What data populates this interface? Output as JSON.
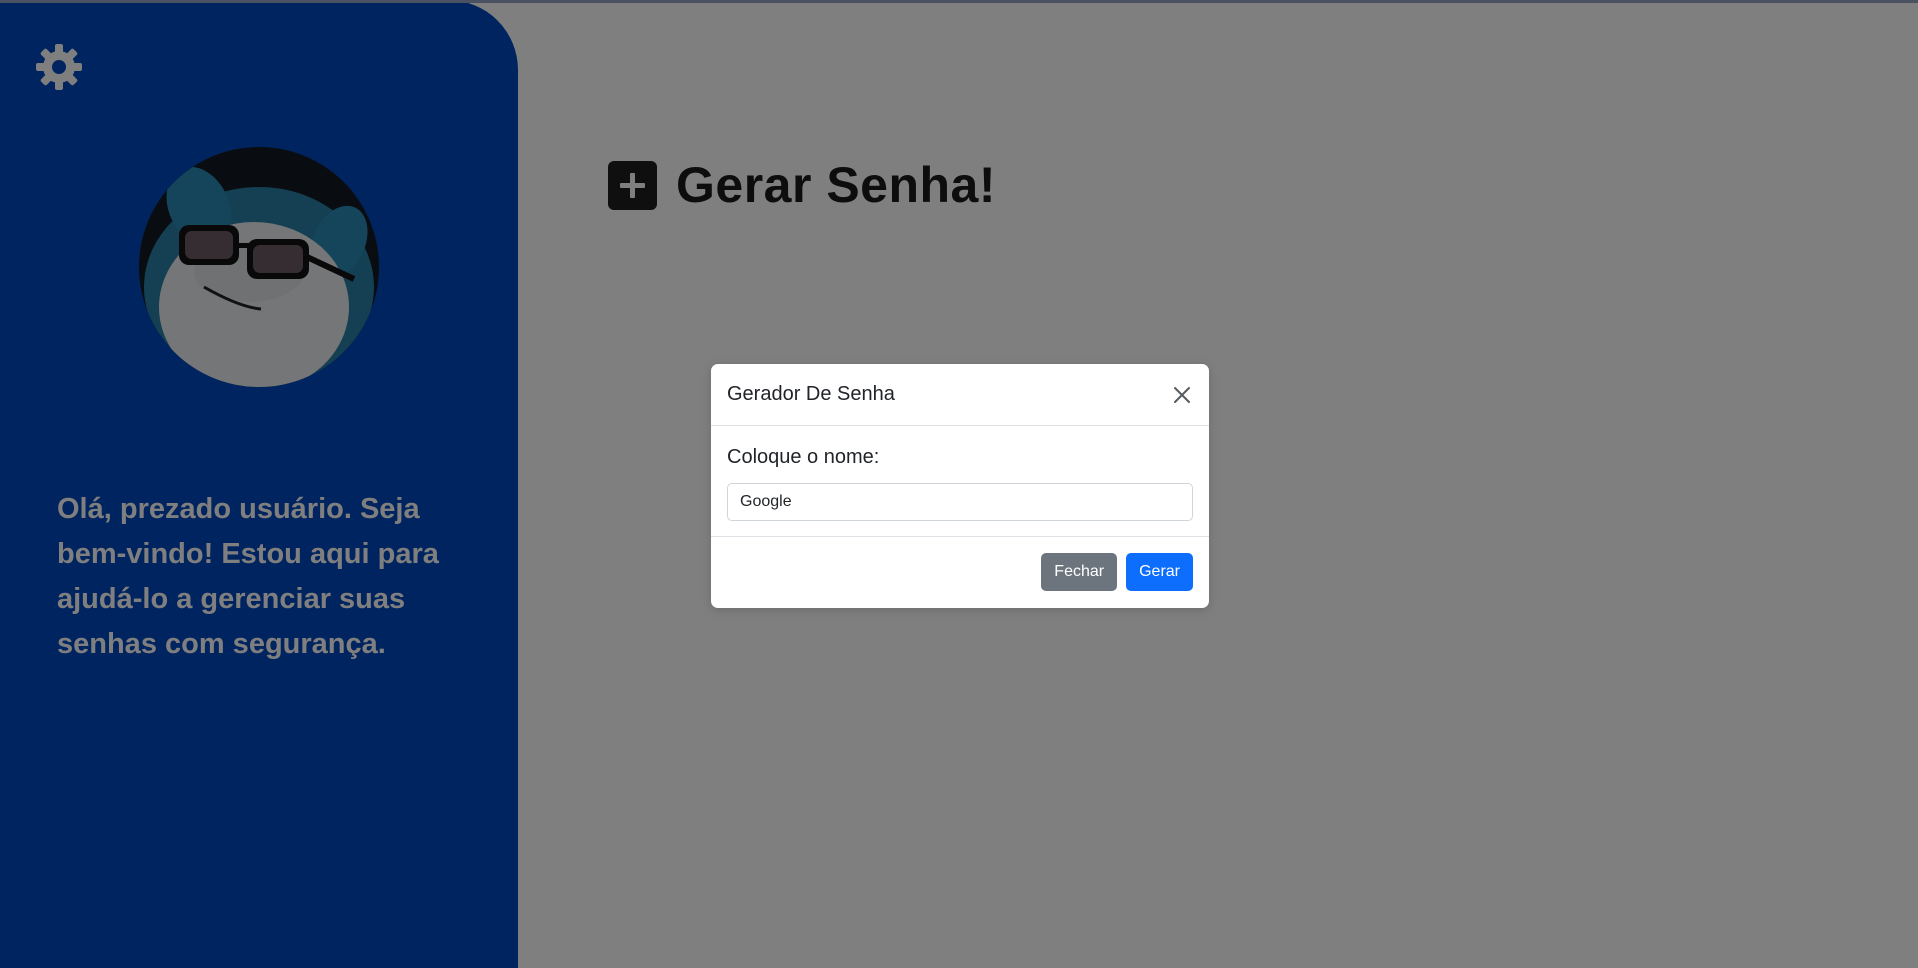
{
  "sidebar": {
    "settings_icon": "gear-icon",
    "avatar_alt": "profile-avatar",
    "welcome_text": "Olá, prezado usuário. Seja bem-vindo! Estou aqui para ajudá-lo a gerenciar suas senhas com segurança."
  },
  "main": {
    "title_icon": "plus-square-icon",
    "title": "Gerar Senha!"
  },
  "modal": {
    "title": "Gerador De Senha",
    "close_icon": "close-icon",
    "field_label": "Coloque o nome:",
    "input_value": "Google",
    "close_button": "Fechar",
    "generate_button": "Gerar"
  },
  "colors": {
    "sidebar": "#0048c0",
    "backdrop": "rgba(0,0,0,0.5)",
    "primary": "#0d6efd",
    "secondary": "#6c757d"
  }
}
